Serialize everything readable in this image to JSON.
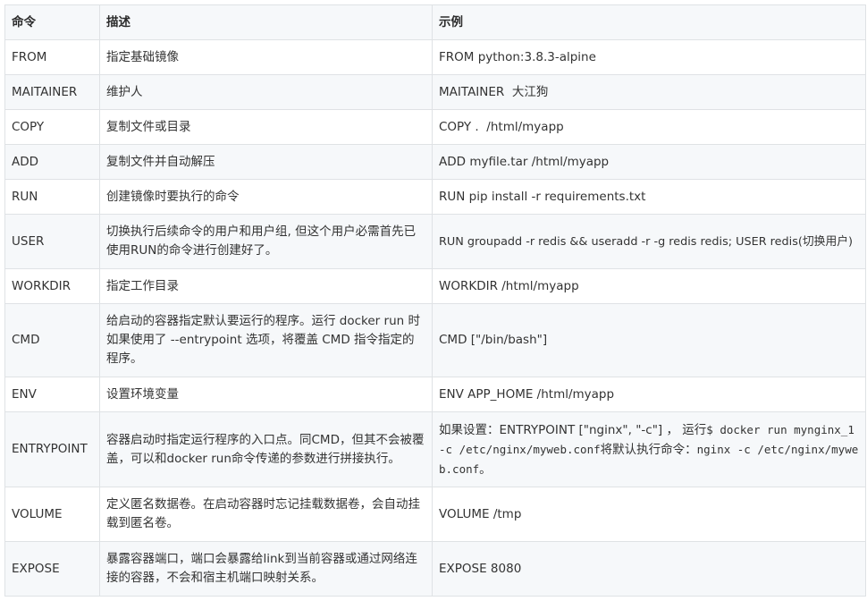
{
  "table": {
    "headers": [
      "命令",
      "描述",
      "示例"
    ],
    "rows": [
      {
        "cmd": "FROM",
        "desc": "指定基础镜像",
        "example": "FROM python:3.8.3-alpine"
      },
      {
        "cmd": "MAITAINER",
        "desc": "维护人",
        "example": "MAITAINER  大江狗"
      },
      {
        "cmd": "COPY",
        "desc": "复制文件或目录",
        "example": "COPY .  /html/myapp"
      },
      {
        "cmd": "ADD",
        "desc": "复制文件并自动解压",
        "example": "ADD myfile.tar /html/myapp"
      },
      {
        "cmd": "RUN",
        "desc": "创建镜像时要执行的命令",
        "example": "RUN pip install -r requirements.txt"
      },
      {
        "cmd": "USER",
        "desc": "切换执行后续命令的用户和用户组, 但这个用户必需首先已使用RUN的命令进行创建好了。",
        "example": "RUN groupadd -r redis && useradd -r -g redis redis; USER redis(切换用户)"
      },
      {
        "cmd": "WORKDIR",
        "desc": "指定工作目录",
        "example": "WORKDIR /html/myapp"
      },
      {
        "cmd": "CMD",
        "desc": "给启动的容器指定默认要运行的程序。运行 docker run 时如果使用了 --entrypoint 选项，将覆盖 CMD 指令指定的程序。",
        "example": "CMD [\"/bin/bash\"]"
      },
      {
        "cmd": "ENV",
        "desc": "设置环境变量",
        "example": "ENV APP_HOME /html/myapp"
      },
      {
        "cmd": "ENTRYPOINT",
        "desc": "容器启动时指定运行程序的入口点。同CMD，但其不会被覆盖，可以和docker run命令传递的参数进行拼接执行。",
        "example": "",
        "example_parts": {
          "prefix": "如果设置：ENTRYPOINT [\"nginx\", \"-c\"] ，  运行",
          "code1": "$ docker run mynginx_1 -c /etc/nginx/myweb.conf",
          "middle": "将默认执行命令：",
          "code2": "nginx -c /etc/nginx/myweb.conf",
          "suffix": "。"
        }
      },
      {
        "cmd": "VOLUME",
        "desc": "定义匿名数据卷。在启动容器时忘记挂载数据卷，会自动挂载到匿名卷。",
        "example": "VOLUME /tmp"
      },
      {
        "cmd": "EXPOSE",
        "desc": "暴露容器端口，端口会暴露给link到当前容器或通过网络连接的容器，不会和宿主机端口映射关系。",
        "example": "EXPOSE 8080"
      }
    ]
  }
}
